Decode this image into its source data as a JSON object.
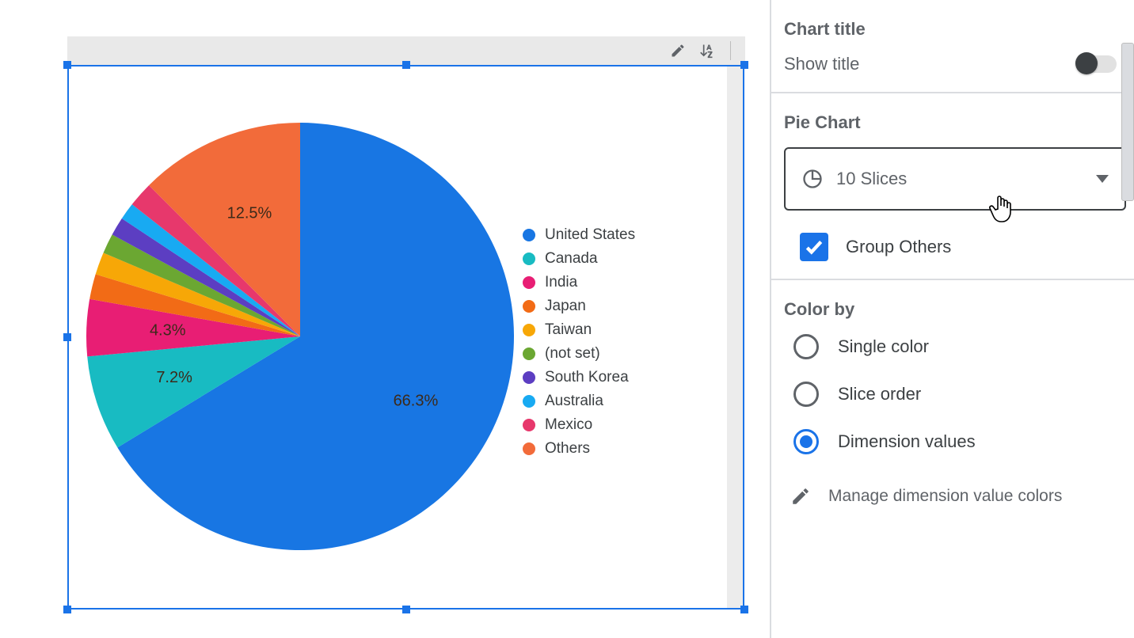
{
  "chart_data": {
    "type": "pie",
    "title": "",
    "series": [
      {
        "name": "United States",
        "value": 66.3,
        "label": "66.3%",
        "color": "#1876e3"
      },
      {
        "name": "Canada",
        "value": 7.2,
        "label": "7.2%",
        "color": "#18bbc2"
      },
      {
        "name": "India",
        "value": 4.3,
        "label": "4.3%",
        "color": "#e81e74"
      },
      {
        "name": "Japan",
        "value": 1.9,
        "label": "",
        "color": "#f26b16"
      },
      {
        "name": "Taiwan",
        "value": 1.7,
        "label": "",
        "color": "#f7a707"
      },
      {
        "name": "(not set)",
        "value": 1.5,
        "label": "",
        "color": "#6ba732"
      },
      {
        "name": "South Korea",
        "value": 1.4,
        "label": "",
        "color": "#5c3ec2"
      },
      {
        "name": "Australia",
        "value": 1.3,
        "label": "",
        "color": "#18aaf2"
      },
      {
        "name": "Mexico",
        "value": 1.9,
        "label": "",
        "color": "#e7386c"
      },
      {
        "name": "Others",
        "value": 12.5,
        "label": "12.5%",
        "color": "#f26b3a"
      }
    ]
  },
  "panel": {
    "title_section_header": "Chart title",
    "show_title_label": "Show title",
    "show_title_on": false,
    "pie_section_header": "Pie Chart",
    "slices_dropdown": "10 Slices",
    "group_others_label": "Group Others",
    "group_others_checked": true,
    "color_by_header": "Color by",
    "color_by_options": {
      "single": "Single color",
      "order": "Slice order",
      "dim": "Dimension values"
    },
    "color_by_selected": "dim",
    "manage_colors": "Manage dimension value colors"
  }
}
